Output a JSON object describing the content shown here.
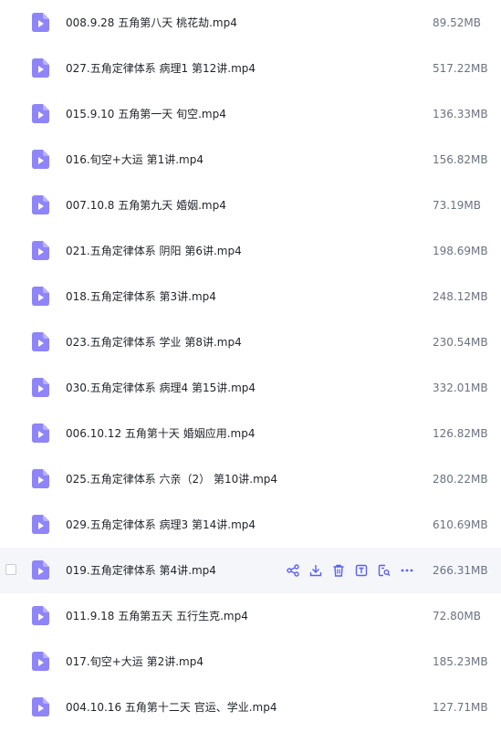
{
  "colors": {
    "accent": "#5b5ff5",
    "icon": "#8f84f8",
    "hover_bg": "#f5f6fa"
  },
  "files": [
    {
      "name": "008.9.28 五角第八天 桃花劫.mp4",
      "size": "89.52MB",
      "icon": "video-file-icon"
    },
    {
      "name": "027.五角定律体系 病理1 第12讲.mp4",
      "size": "517.22MB",
      "icon": "video-file-icon"
    },
    {
      "name": "015.9.10 五角第一天 旬空.mp4",
      "size": "136.33MB",
      "icon": "video-file-icon"
    },
    {
      "name": "016.旬空+大运 第1讲.mp4",
      "size": "156.82MB",
      "icon": "video-file-icon"
    },
    {
      "name": "007.10.8 五角第九天 婚姻.mp4",
      "size": "73.19MB",
      "icon": "video-file-icon"
    },
    {
      "name": "021.五角定律体系 阴阳 第6讲.mp4",
      "size": "198.69MB",
      "icon": "video-file-icon"
    },
    {
      "name": "018.五角定律体系 第3讲.mp4",
      "size": "248.12MB",
      "icon": "video-file-icon"
    },
    {
      "name": "023.五角定律体系 学业 第8讲.mp4",
      "size": "230.54MB",
      "icon": "video-file-icon"
    },
    {
      "name": "030.五角定律体系 病理4 第15讲.mp4",
      "size": "332.01MB",
      "icon": "video-file-icon"
    },
    {
      "name": "006.10.12 五角第十天 婚姻应用.mp4",
      "size": "126.82MB",
      "icon": "video-file-icon"
    },
    {
      "name": "025.五角定律体系 六亲（2） 第10讲.mp4",
      "size": "280.22MB",
      "icon": "video-file-icon"
    },
    {
      "name": "029.五角定律体系 病理3 第14讲.mp4",
      "size": "610.69MB",
      "icon": "video-file-icon"
    },
    {
      "name": "019.五角定律体系 第4讲.mp4",
      "size": "266.31MB",
      "icon": "video-file-icon",
      "hovered": true
    },
    {
      "name": "011.9.18 五角第五天 五行生克.mp4",
      "size": "72.80MB",
      "icon": "video-file-icon"
    },
    {
      "name": "017.旬空+大运 第2讲.mp4",
      "size": "185.23MB",
      "icon": "video-file-icon"
    },
    {
      "name": "004.10.16 五角第十二天 官运、学业.mp4",
      "size": "127.71MB",
      "icon": "video-file-icon"
    }
  ],
  "row_actions": [
    "share-icon",
    "download-icon",
    "delete-icon",
    "text-extract-icon",
    "image-search-icon",
    "more-icon"
  ]
}
